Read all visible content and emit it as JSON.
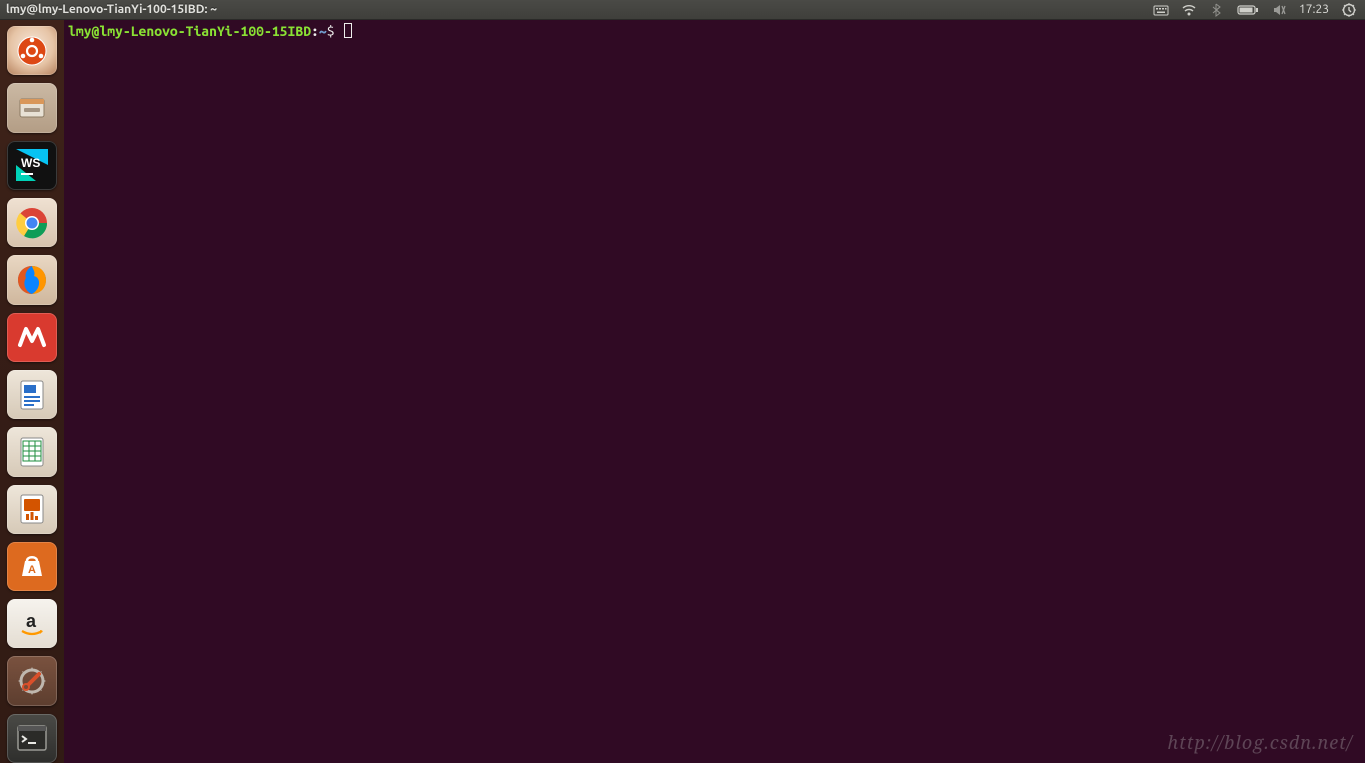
{
  "menubar": {
    "title": "lmy@lmy-Lenovo-TianYi-100-15IBD: ~",
    "clock": "17:23"
  },
  "launcher": {
    "items": [
      {
        "name": "dash"
      },
      {
        "name": "files"
      },
      {
        "name": "webstorm"
      },
      {
        "name": "chrome"
      },
      {
        "name": "firefox"
      },
      {
        "name": "xmind"
      },
      {
        "name": "writer"
      },
      {
        "name": "calc"
      },
      {
        "name": "impress"
      },
      {
        "name": "software"
      },
      {
        "name": "amazon"
      },
      {
        "name": "settings"
      },
      {
        "name": "terminal"
      }
    ]
  },
  "terminal": {
    "user": "lmy@lmy-Lenovo-TianYi-100-15IBD",
    "colon": ":",
    "path": "~",
    "dollar": "$"
  },
  "watermark": "http://blog.csdn.net/"
}
